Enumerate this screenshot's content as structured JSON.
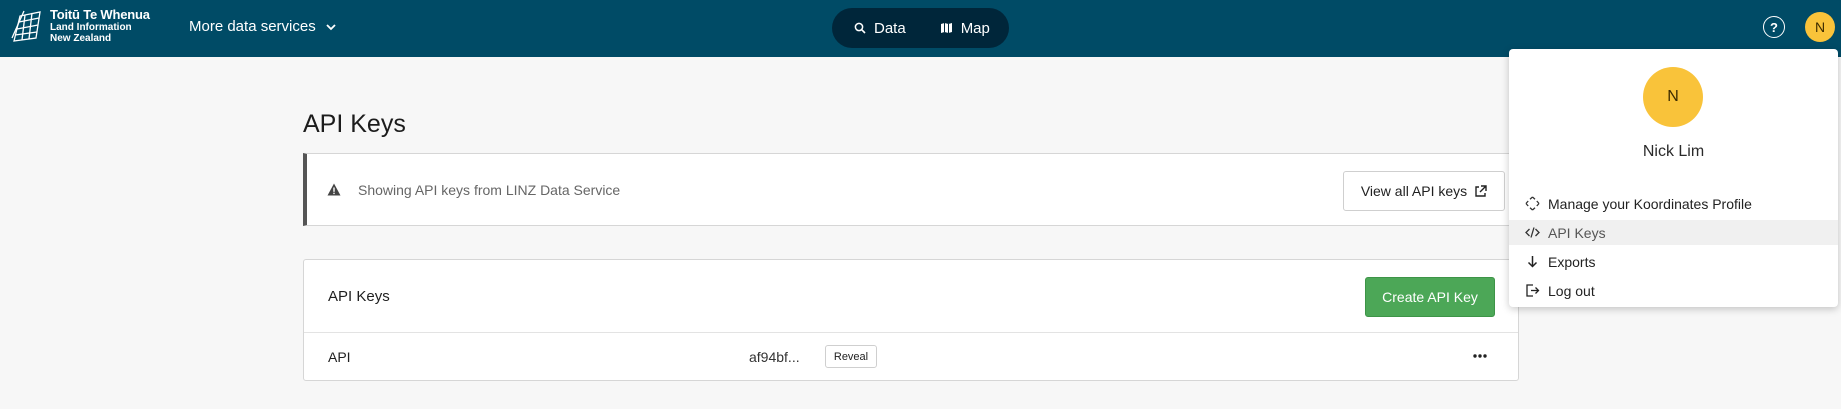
{
  "header": {
    "logo": {
      "line1": "Toitū Te Whenua",
      "line2": "Land Information",
      "line3": "New Zealand",
      "icon": "linz-logo-icon"
    },
    "more_services_label": "More data services",
    "switcher": {
      "data_label": "Data",
      "map_label": "Map"
    },
    "help_symbol": "?",
    "avatar_initial": "N"
  },
  "main": {
    "title": "API Keys",
    "notice": {
      "message": "Showing API keys from LINZ Data Service",
      "button_label": "View all API keys",
      "icon": "warning-icon"
    },
    "card": {
      "title": "API Keys",
      "create_label": "Create API Key",
      "rows": [
        {
          "name": "API",
          "key": "af94bf...",
          "reveal_label": "Reveal"
        }
      ]
    }
  },
  "user_menu": {
    "avatar_initial": "N",
    "user_name": "Nick Lim",
    "items": [
      {
        "label": "Manage your Koordinates Profile",
        "icon": "profile-expand-icon"
      },
      {
        "label": "API Keys",
        "icon": "code-icon",
        "active": true
      },
      {
        "label": "Exports",
        "icon": "arrow-down-icon"
      },
      {
        "label": "Log out",
        "icon": "logout-icon"
      }
    ]
  },
  "colors": {
    "header_bg": "#004b66",
    "switcher_bg": "#00263a",
    "avatar": "#f9c33a",
    "create_button": "#4ca757"
  }
}
